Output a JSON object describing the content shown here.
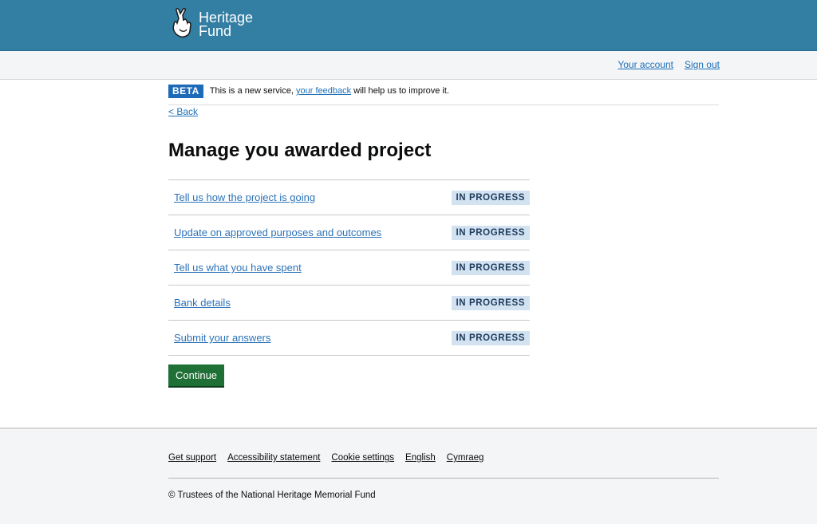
{
  "header": {
    "logo_line1": "Heritage",
    "logo_line2": "Fund",
    "logo_icon": "crossed-fingers-icon",
    "brand_color": "#337ea3"
  },
  "subnav": {
    "your_account": "Your account",
    "sign_out": "Sign out"
  },
  "beta_banner": {
    "tag": "BETA",
    "text_before": "This is a new service, ",
    "link": "your feedback",
    "text_after": " will help us to improve it."
  },
  "back_link": "< Back",
  "page_title": "Manage you awarded project",
  "tasks": [
    {
      "label": "Tell us how the project is going",
      "status": "IN PROGRESS"
    },
    {
      "label": "Update on approved purposes and outcomes",
      "status": "IN PROGRESS"
    },
    {
      "label": "Tell us what you have spent",
      "status": "IN PROGRESS"
    },
    {
      "label": "Bank details",
      "status": "IN PROGRESS"
    },
    {
      "label": "Submit your answers",
      "status": "IN PROGRESS"
    }
  ],
  "continue_button": "Continue",
  "footer": {
    "links": [
      "Get support",
      "Accessibility statement",
      "Cookie settings",
      "English",
      "Cymraeg"
    ],
    "copyright": "© Trustees of the National Heritage Memorial Fund"
  }
}
